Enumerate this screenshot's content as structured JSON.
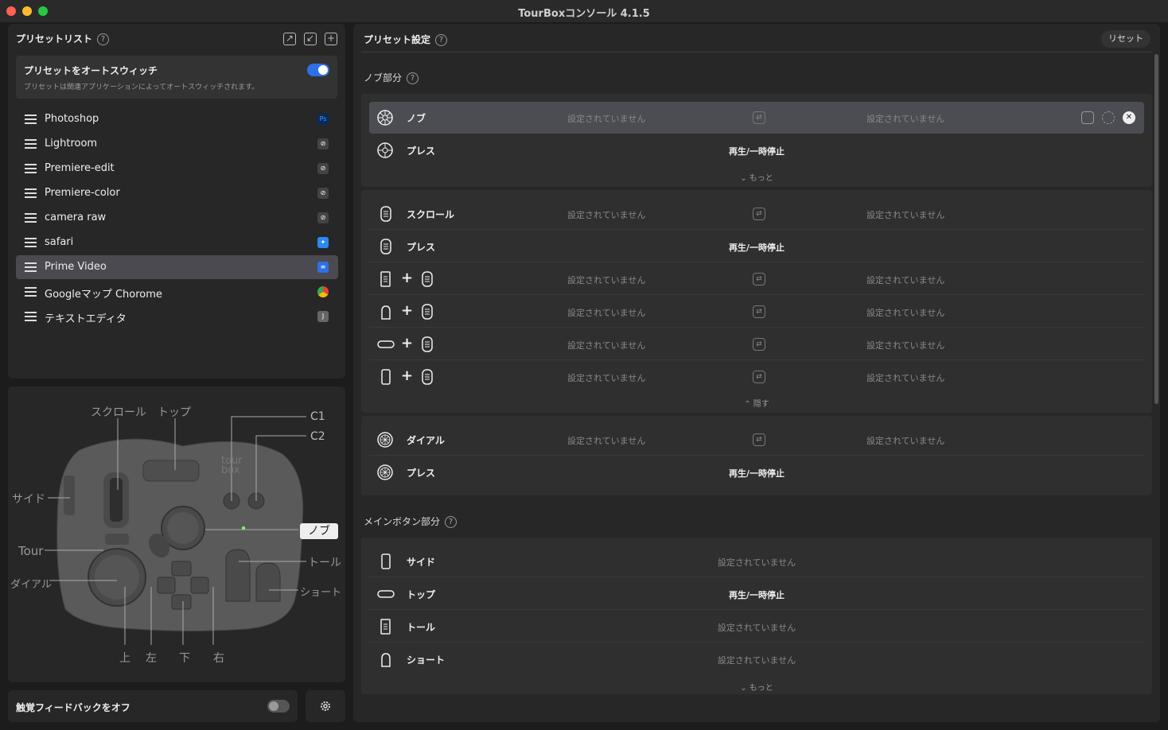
{
  "window": {
    "title": "TourBoxコンソール 4.1.5"
  },
  "preset_list": {
    "title": "プリセットリスト",
    "help": "?",
    "auto_switch": {
      "title": "プリセットをオートスウィッチ",
      "description": "プリセットは関連アプリケーションによってオートスウィッチされます。",
      "enabled": true
    },
    "items": [
      {
        "label": "Photoshop",
        "badge": "Ps",
        "badge_color": "#0b2a5a"
      },
      {
        "label": "Lightroom",
        "badge": "",
        "badge_color": "#444"
      },
      {
        "label": "Premiere-edit",
        "badge": "",
        "badge_color": "#444"
      },
      {
        "label": "Premiere-color",
        "badge": "",
        "badge_color": "#444"
      },
      {
        "label": "camera raw",
        "badge": "",
        "badge_color": "#444"
      },
      {
        "label": "safari",
        "badge": "",
        "badge_color": "#2a8af0"
      },
      {
        "label": "Prime Video",
        "badge": "",
        "badge_color": "#2f6fe8",
        "selected": true
      },
      {
        "label": "Googleマップ Chorome",
        "badge": "",
        "badge_color": "#e94235"
      },
      {
        "label": "テキストエディタ",
        "badge": "J",
        "badge_color": "#666"
      }
    ]
  },
  "device": {
    "labels": {
      "scroll": "スクロール",
      "top": "トップ",
      "c1": "C1",
      "c2": "C2",
      "side": "サイド",
      "knob": "ノブ",
      "tour": "Tour",
      "tall": "トール",
      "dial": "ダイアル",
      "short": "ショート",
      "up": "上",
      "left": "左",
      "down": "下",
      "right": "右",
      "logo": "tour box"
    }
  },
  "haptic": {
    "label": "触覚フィードバックをオフ",
    "enabled": false
  },
  "settings": {
    "title": "プリセット設定",
    "help": "?",
    "reset": "リセット",
    "not_set": "設定されていません",
    "knob_section": {
      "title": "ノブ部分",
      "rows": [
        {
          "name": "ノブ",
          "left": "設定されていません",
          "right": "設定されていません"
        },
        {
          "name": "プレス",
          "value": "再生/一時停止"
        }
      ],
      "more": "もっと"
    },
    "scroll_section": {
      "rows": [
        {
          "name": "スクロール",
          "left": "設定されていません",
          "right": "設定されていません"
        },
        {
          "name": "プレス",
          "value": "再生/一時停止"
        },
        {
          "combo": "tall+scroll",
          "left": "設定されていません",
          "right": "設定されていません"
        },
        {
          "combo": "short+scroll",
          "left": "設定されていません",
          "right": "設定されていません"
        },
        {
          "combo": "top+scroll",
          "left": "設定されていません",
          "right": "設定されていません"
        },
        {
          "combo": "side+scroll",
          "left": "設定されていません",
          "right": "設定されていません"
        }
      ],
      "hide": "隠す"
    },
    "dial_section": {
      "rows": [
        {
          "name": "ダイアル",
          "left": "設定されていません",
          "right": "設定されていません"
        },
        {
          "name": "プレス",
          "value": "再生/一時停止"
        }
      ]
    },
    "main_section": {
      "title": "メインボタン部分",
      "rows": [
        {
          "name": "サイド",
          "value": "設定されていません"
        },
        {
          "name": "トップ",
          "value": "再生/一時停止"
        },
        {
          "name": "トール",
          "value": "設定されていません"
        },
        {
          "name": "ショート",
          "value": "設定されていません"
        }
      ],
      "more": "もっと"
    }
  }
}
